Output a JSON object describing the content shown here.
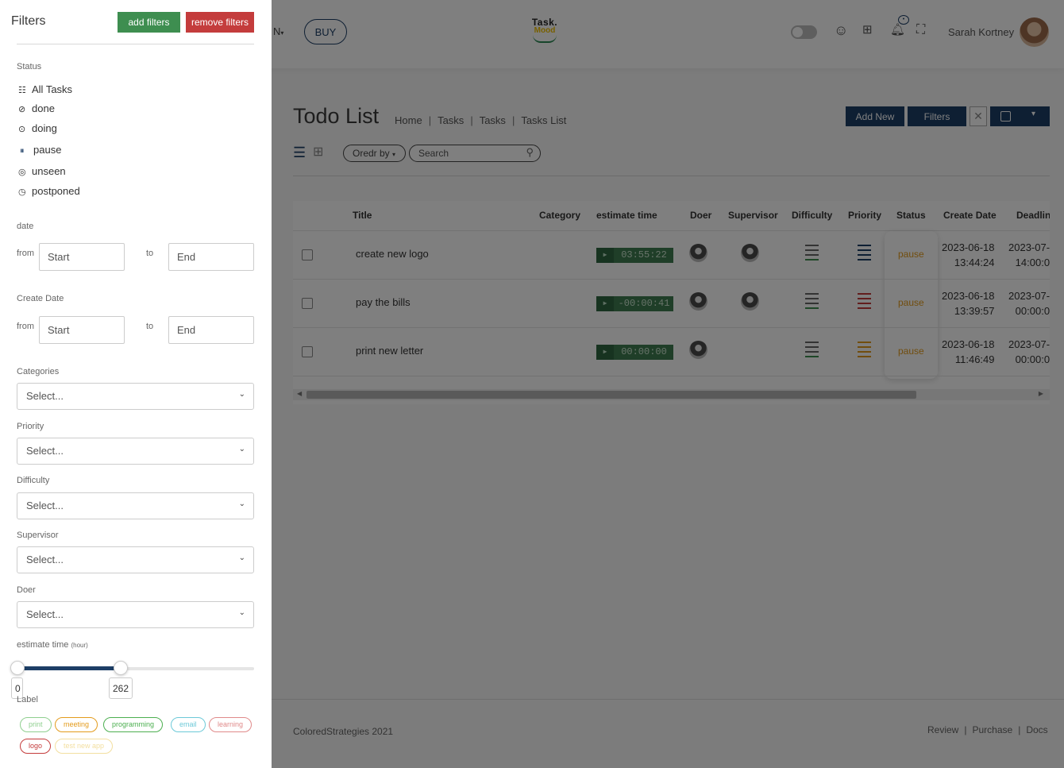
{
  "header": {
    "lang_label": "N",
    "buy_label": "BUY",
    "logo_line1": "Task.",
    "logo_line2": "Mood",
    "user_name": "Sarah Kortney",
    "icons": [
      "smile-icon",
      "apps-grid-icon",
      "bell-icon",
      "fullscreen-icon"
    ]
  },
  "page": {
    "title": "Todo List",
    "breadcrumb": [
      "Home",
      "Tasks",
      "Tasks",
      "Tasks List"
    ],
    "add_new_label": "Add New",
    "filters_label": "Filters",
    "close_label": "✕",
    "order_by_label": "Oredr by",
    "search_placeholder": "Search"
  },
  "table": {
    "columns": [
      "Title",
      "Category",
      "estimate time",
      "Doer",
      "Supervisor",
      "Difficulty",
      "Priority",
      "Status",
      "Create Date",
      "Deadlin"
    ],
    "rows": [
      {
        "title": "create new logo",
        "timer": "03:55:22",
        "status": "pause",
        "created_date": "2023-06-18",
        "created_time": "13:44:24",
        "deadline_date": "2023-07-",
        "deadline_time": "14:00:0",
        "priority_color": "#1d3e66",
        "difficulty_color": "#3e8e50",
        "supervisor": true
      },
      {
        "title": "pay the bills",
        "timer": "-00:00:41",
        "status": "pause",
        "created_date": "2023-06-18",
        "created_time": "13:39:57",
        "deadline_date": "2023-07-",
        "deadline_time": "00:00:0",
        "priority_color": "#c43c3c",
        "difficulty_color": "#3e8e50",
        "supervisor": true
      },
      {
        "title": "print new letter",
        "timer": "00:00:00",
        "status": "pause",
        "created_date": "2023-06-18",
        "created_time": "11:46:49",
        "deadline_date": "2023-07-",
        "deadline_time": "00:00:0",
        "priority_color": "#e39b1c",
        "difficulty_color": "#3e8e50",
        "supervisor": false
      }
    ]
  },
  "footer": {
    "copyright": "ColoredStrategies 2021",
    "links": [
      "Review",
      "Purchase",
      "Docs"
    ]
  },
  "filters": {
    "title": "Filters",
    "add_label": "add filters",
    "remove_label": "remove filters",
    "status_label": "Status",
    "status_items": [
      {
        "label": "All Tasks",
        "icon": "list-icon"
      },
      {
        "label": "done",
        "icon": "check-circle-icon"
      },
      {
        "label": "doing",
        "icon": "play-circle-icon"
      },
      {
        "label": "pause",
        "icon": "pause-circle-icon"
      },
      {
        "label": "unseen",
        "icon": "eye-off-icon"
      },
      {
        "label": "postponed",
        "icon": "clock-icon"
      }
    ],
    "date_label": "date",
    "create_date_label": "Create Date",
    "from_label": "from",
    "to_label": "to",
    "start_placeholder": "Start",
    "end_placeholder": "End",
    "categories_label": "Categories",
    "priority_label": "Priority",
    "difficulty_label": "Difficulty",
    "supervisor_label": "Supervisor",
    "doer_label": "Doer",
    "select_placeholder": "Select...",
    "estimate_label": "estimate time",
    "estimate_unit": "(hour)",
    "estimate_min": "0",
    "estimate_max": "262",
    "label_label": "Label",
    "tags": [
      {
        "text": "print",
        "color": "#8fcf8f"
      },
      {
        "text": "meeting",
        "color": "#e39b1c"
      },
      {
        "text": "programming",
        "color": "#4caf50"
      },
      {
        "text": "email",
        "color": "#6cc9d8"
      },
      {
        "text": "learning",
        "color": "#e08a8a"
      },
      {
        "text": "logo",
        "color": "#c43c3c"
      },
      {
        "text": "test new app",
        "color": "#f3dfa0"
      }
    ]
  }
}
